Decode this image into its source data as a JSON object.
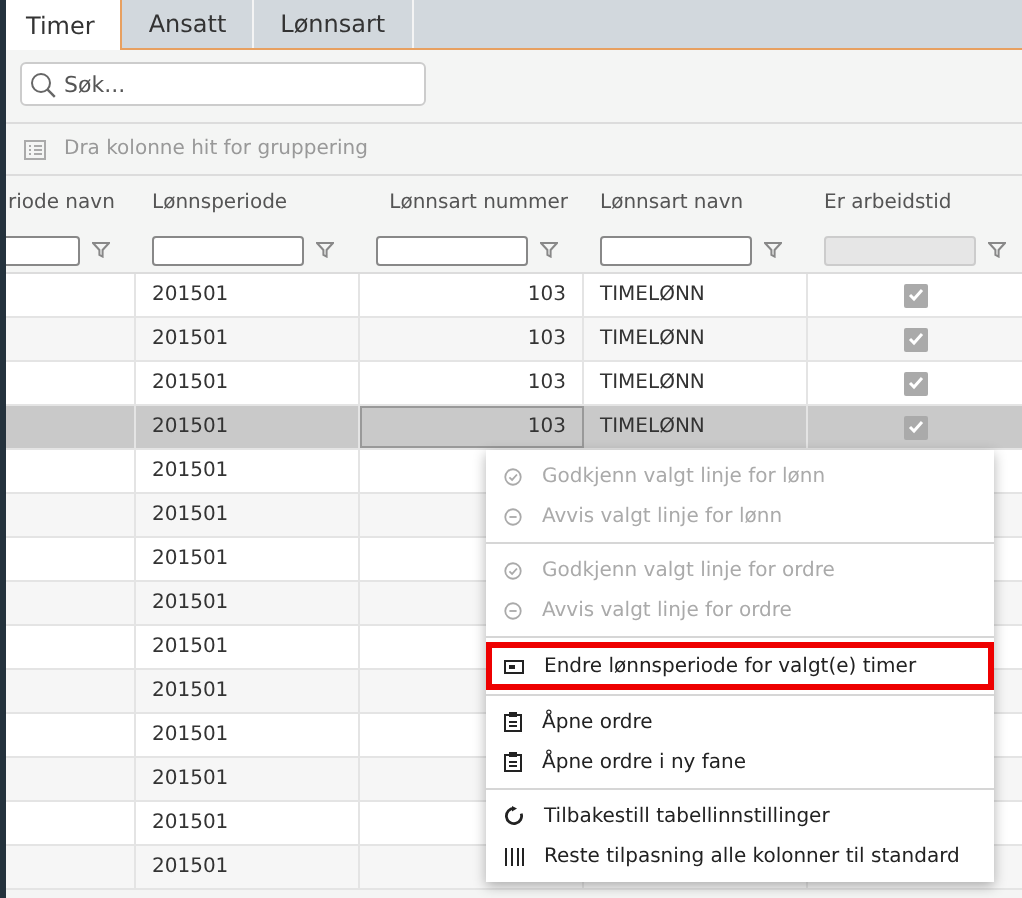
{
  "tabs": [
    {
      "label": "Timer",
      "selected": true
    },
    {
      "label": "Ansatt",
      "selected": false
    },
    {
      "label": "Lønnsart",
      "selected": false
    }
  ],
  "search": {
    "placeholder": "Søk..."
  },
  "group_bar": {
    "label": "Dra kolonne hit for gruppering"
  },
  "table": {
    "columns": [
      {
        "label": "riode navn",
        "filter": true
      },
      {
        "label": "Lønnsperiode",
        "filter": true
      },
      {
        "label": "Lønnsart nummer",
        "filter": true
      },
      {
        "label": "Lønnsart navn",
        "filter": true
      },
      {
        "label": "Er arbeidstid",
        "filter": false
      }
    ],
    "rows": [
      {
        "selected": false,
        "period": "201501",
        "number": "103",
        "name": "TIMELØNN",
        "working_time": true
      },
      {
        "selected": false,
        "period": "201501",
        "number": "103",
        "name": "TIMELØNN",
        "working_time": true
      },
      {
        "selected": false,
        "period": "201501",
        "number": "103",
        "name": "TIMELØNN",
        "working_time": true
      },
      {
        "selected": true,
        "period": "201501",
        "number": "103",
        "name": "TIMELØNN",
        "working_time": true
      },
      {
        "selected": false,
        "period": "201501"
      },
      {
        "selected": false,
        "period": "201501"
      },
      {
        "selected": false,
        "period": "201501"
      },
      {
        "selected": false,
        "period": "201501"
      },
      {
        "selected": false,
        "period": "201501"
      },
      {
        "selected": false,
        "period": "201501"
      },
      {
        "selected": false,
        "period": "201501"
      },
      {
        "selected": false,
        "period": "201501"
      },
      {
        "selected": false,
        "period": "201501"
      },
      {
        "selected": false,
        "period": "201501"
      }
    ]
  },
  "context_menu": {
    "groups": [
      {
        "items": [
          {
            "label": "Godkjenn valgt linje for lønn",
            "kind": "approve",
            "disabled": true,
            "highlighted": false
          },
          {
            "label": "Avvis valgt linje for lønn",
            "kind": "reject",
            "disabled": true,
            "highlighted": false
          }
        ]
      },
      {
        "items": [
          {
            "label": "Godkjenn valgt linje for ordre",
            "kind": "approve",
            "disabled": true,
            "highlighted": false
          },
          {
            "label": "Avvis valgt linje for ordre",
            "kind": "reject",
            "disabled": true,
            "highlighted": false
          }
        ]
      },
      {
        "items": [
          {
            "label": "Endre lønnsperiode for valgt(e) timer",
            "kind": "change",
            "disabled": false,
            "highlighted": true
          }
        ]
      },
      {
        "items": [
          {
            "label": "Åpne ordre",
            "kind": "open",
            "disabled": false,
            "highlighted": false
          },
          {
            "label": "Åpne ordre i ny fane",
            "kind": "open",
            "disabled": false,
            "highlighted": false
          }
        ]
      },
      {
        "items": [
          {
            "label": "Tilbakestill tabellinnstillinger",
            "kind": "reset",
            "disabled": false,
            "highlighted": false
          },
          {
            "label": "Reste tilpasning alle kolonner til standard",
            "kind": "columns",
            "disabled": false,
            "highlighted": false
          }
        ]
      }
    ]
  }
}
